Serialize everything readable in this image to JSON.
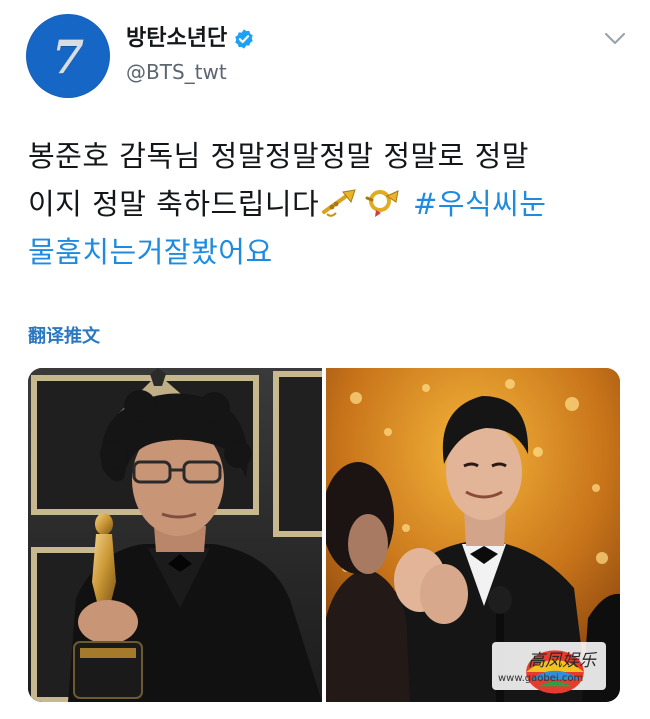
{
  "author": {
    "display_name": "방탄소년단",
    "handle": "@BTS_twt",
    "avatar_glyph": "7",
    "verified": true
  },
  "icons": {
    "verified": "verified-badge-icon",
    "more": "chevron-down-icon",
    "emoji_1": "trumpet-emoji",
    "emoji_2": "postal-horn-emoji"
  },
  "tweet": {
    "line1": "봉준호 감독님 정말정말정말 정말로 정말",
    "line2_text": "이지 정말 축하드립니다",
    "hashtag_part1": "#우식씨눈",
    "hashtag_part2": "물훔치는거잘봤어요"
  },
  "translate_label": "翻译推文",
  "media": {
    "count": 2
  },
  "watermark": {
    "title": "高凤娱乐",
    "url": "www.gaobei.com"
  },
  "colors": {
    "link": "#1d8ce0",
    "avatar": "#1666c5",
    "verified": "#1da1f2",
    "handle": "#5b6670"
  }
}
